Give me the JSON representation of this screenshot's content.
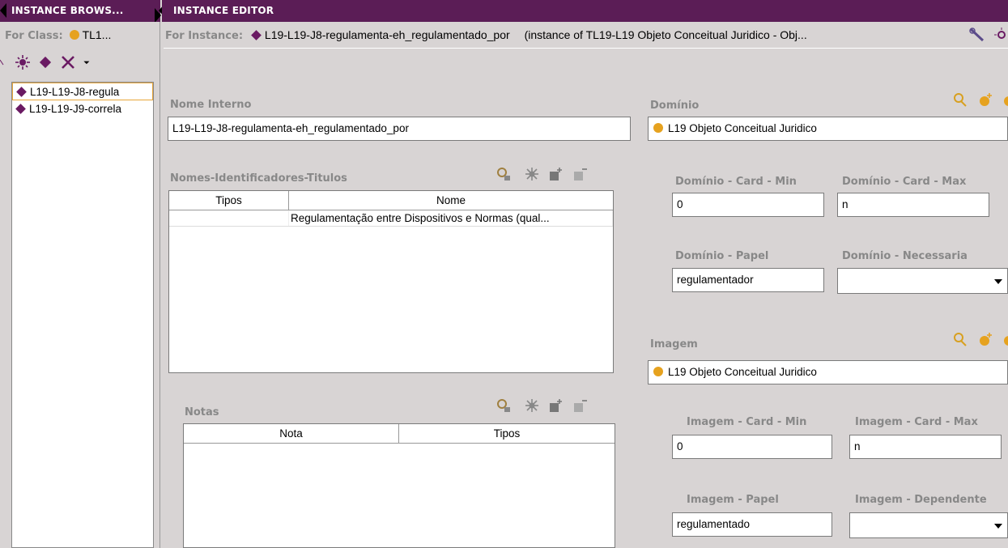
{
  "browser": {
    "title": "INSTANCE BROWS...",
    "for_class_label": "For Class:",
    "for_class_value": "TL1...",
    "instances": [
      {
        "label": "L19-L19-J8-regula",
        "selected": true
      },
      {
        "label": "L19-L19-J9-correla",
        "selected": false
      }
    ]
  },
  "editor": {
    "title": "INSTANCE EDITOR",
    "for_instance_label": "For Instance:",
    "instance_name": "L19-L19-J8-regulamenta-eh_regulamentado_por",
    "instance_of": "(instance of TL19-L19 Objeto Conceitual Juridico - Obj...",
    "nome_interno": {
      "label": "Nome Interno",
      "value": "L19-L19-J8-regulamenta-eh_regulamentado_por"
    },
    "nomes_table": {
      "label": "Nomes-Identificadores-Titulos",
      "columns": [
        "Tipos",
        "Nome"
      ],
      "rows": [
        [
          "",
          "Regulamentação entre Dispositivos e Normas (qual..."
        ]
      ]
    },
    "notas_table": {
      "label": "Notas",
      "columns": [
        "Nota",
        "Tipos"
      ],
      "rows": []
    },
    "dominio": {
      "label": "Domínio",
      "value": "L19 Objeto Conceitual Juridico",
      "card_min_label": "Domínio - Card - Min",
      "card_min": "0",
      "card_max_label": "Domínio - Card - Max",
      "card_max": "n",
      "papel_label": "Domínio - Papel",
      "papel": "regulamentador",
      "necessaria_label": "Domínio - Necessaria",
      "necessaria": ""
    },
    "imagem": {
      "label": "Imagem",
      "value": "L19 Objeto Conceitual Juridico",
      "card_min_label": "Imagem - Card - Min",
      "card_min": "0",
      "card_max_label": "Imagem - Card - Max",
      "card_max": "n",
      "papel_label": "Imagem - Papel",
      "papel": "regulamentado",
      "dependente_label": "Imagem - Dependente",
      "dependente": ""
    }
  },
  "colors": {
    "titlebar": "#5b1d56",
    "class_dot": "#e6a21f",
    "instance_diamond": "#6a1a63",
    "selection_border": "#e8a63a"
  }
}
